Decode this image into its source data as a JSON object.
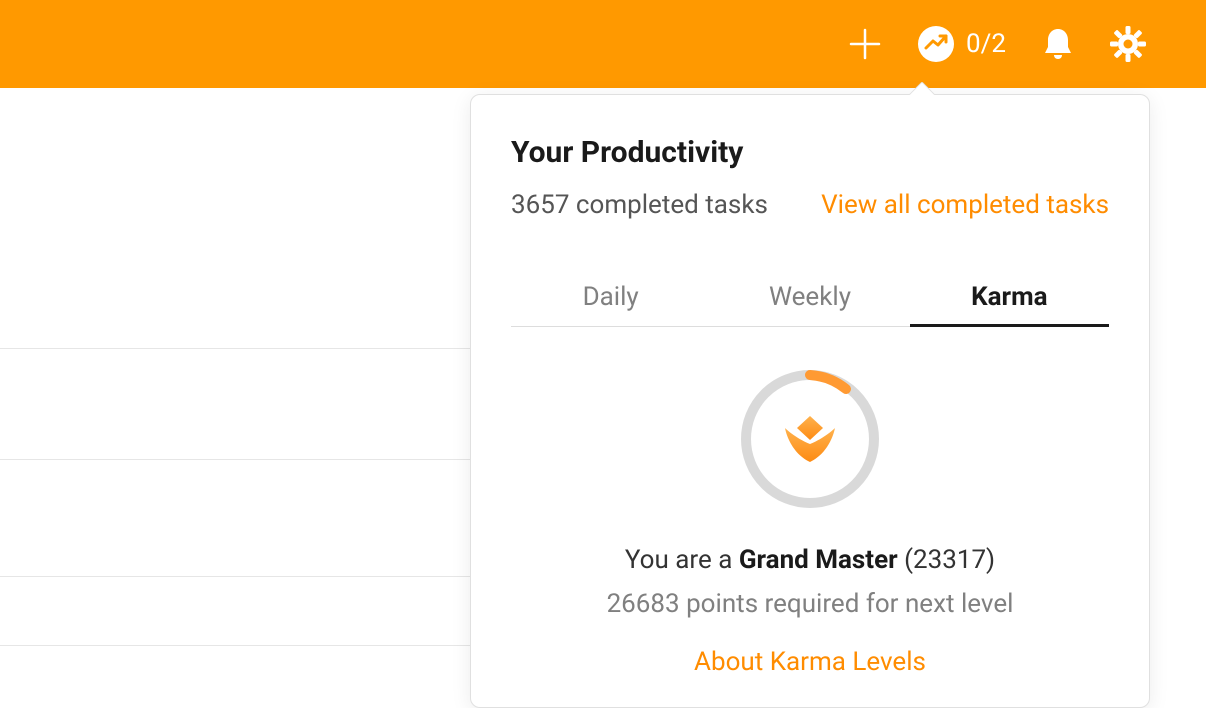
{
  "colors": {
    "brand": "#ff9900",
    "accent": "#ff8c00"
  },
  "header": {
    "productivity_count": "0/2"
  },
  "popover": {
    "title": "Your Productivity",
    "completed_text": "3657 completed tasks",
    "view_all_label": "View all completed tasks",
    "tabs": [
      {
        "label": "Daily",
        "active": false
      },
      {
        "label": "Weekly",
        "active": false
      },
      {
        "label": "Karma",
        "active": true
      }
    ],
    "karma": {
      "status_prefix": "You are a ",
      "level": "Grand Master",
      "status_suffix": " (23317)",
      "points_required": "26683 points required for next level",
      "about_link_label": "About Karma Levels"
    }
  }
}
